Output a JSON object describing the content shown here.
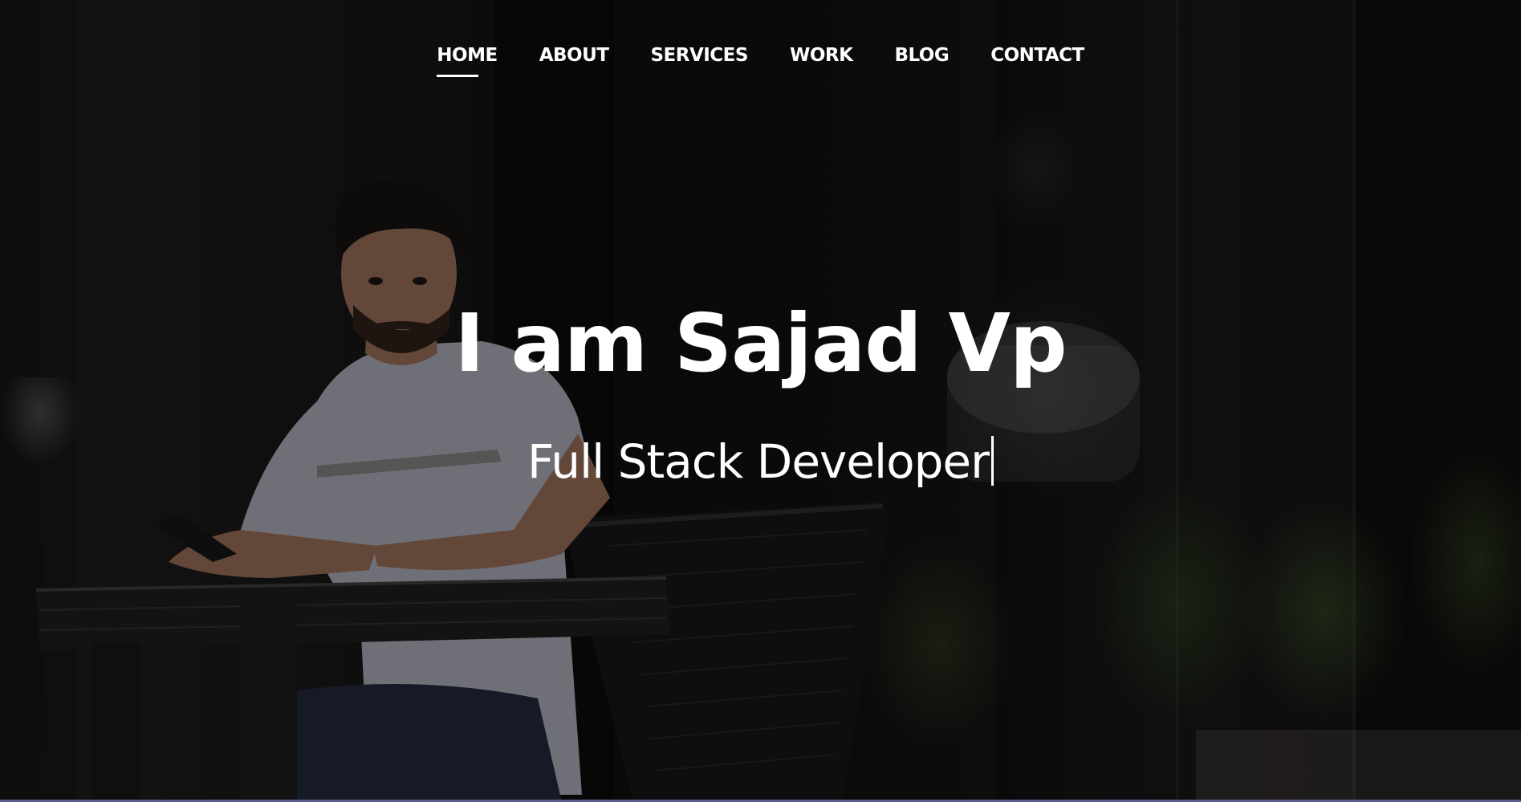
{
  "nav": {
    "items": [
      {
        "label": "HOME",
        "active": true
      },
      {
        "label": "ABOUT",
        "active": false
      },
      {
        "label": "SERVICES",
        "active": false
      },
      {
        "label": "WORK",
        "active": false
      },
      {
        "label": "BLOG",
        "active": false
      },
      {
        "label": "CONTACT",
        "active": false
      }
    ]
  },
  "hero": {
    "title": "I am Sajad Vp",
    "subtitle": "Full Stack Developer"
  },
  "colors": {
    "text": "#ffffff",
    "background": "#0d0d0d",
    "bottom_strip": "#5a5a8c"
  }
}
